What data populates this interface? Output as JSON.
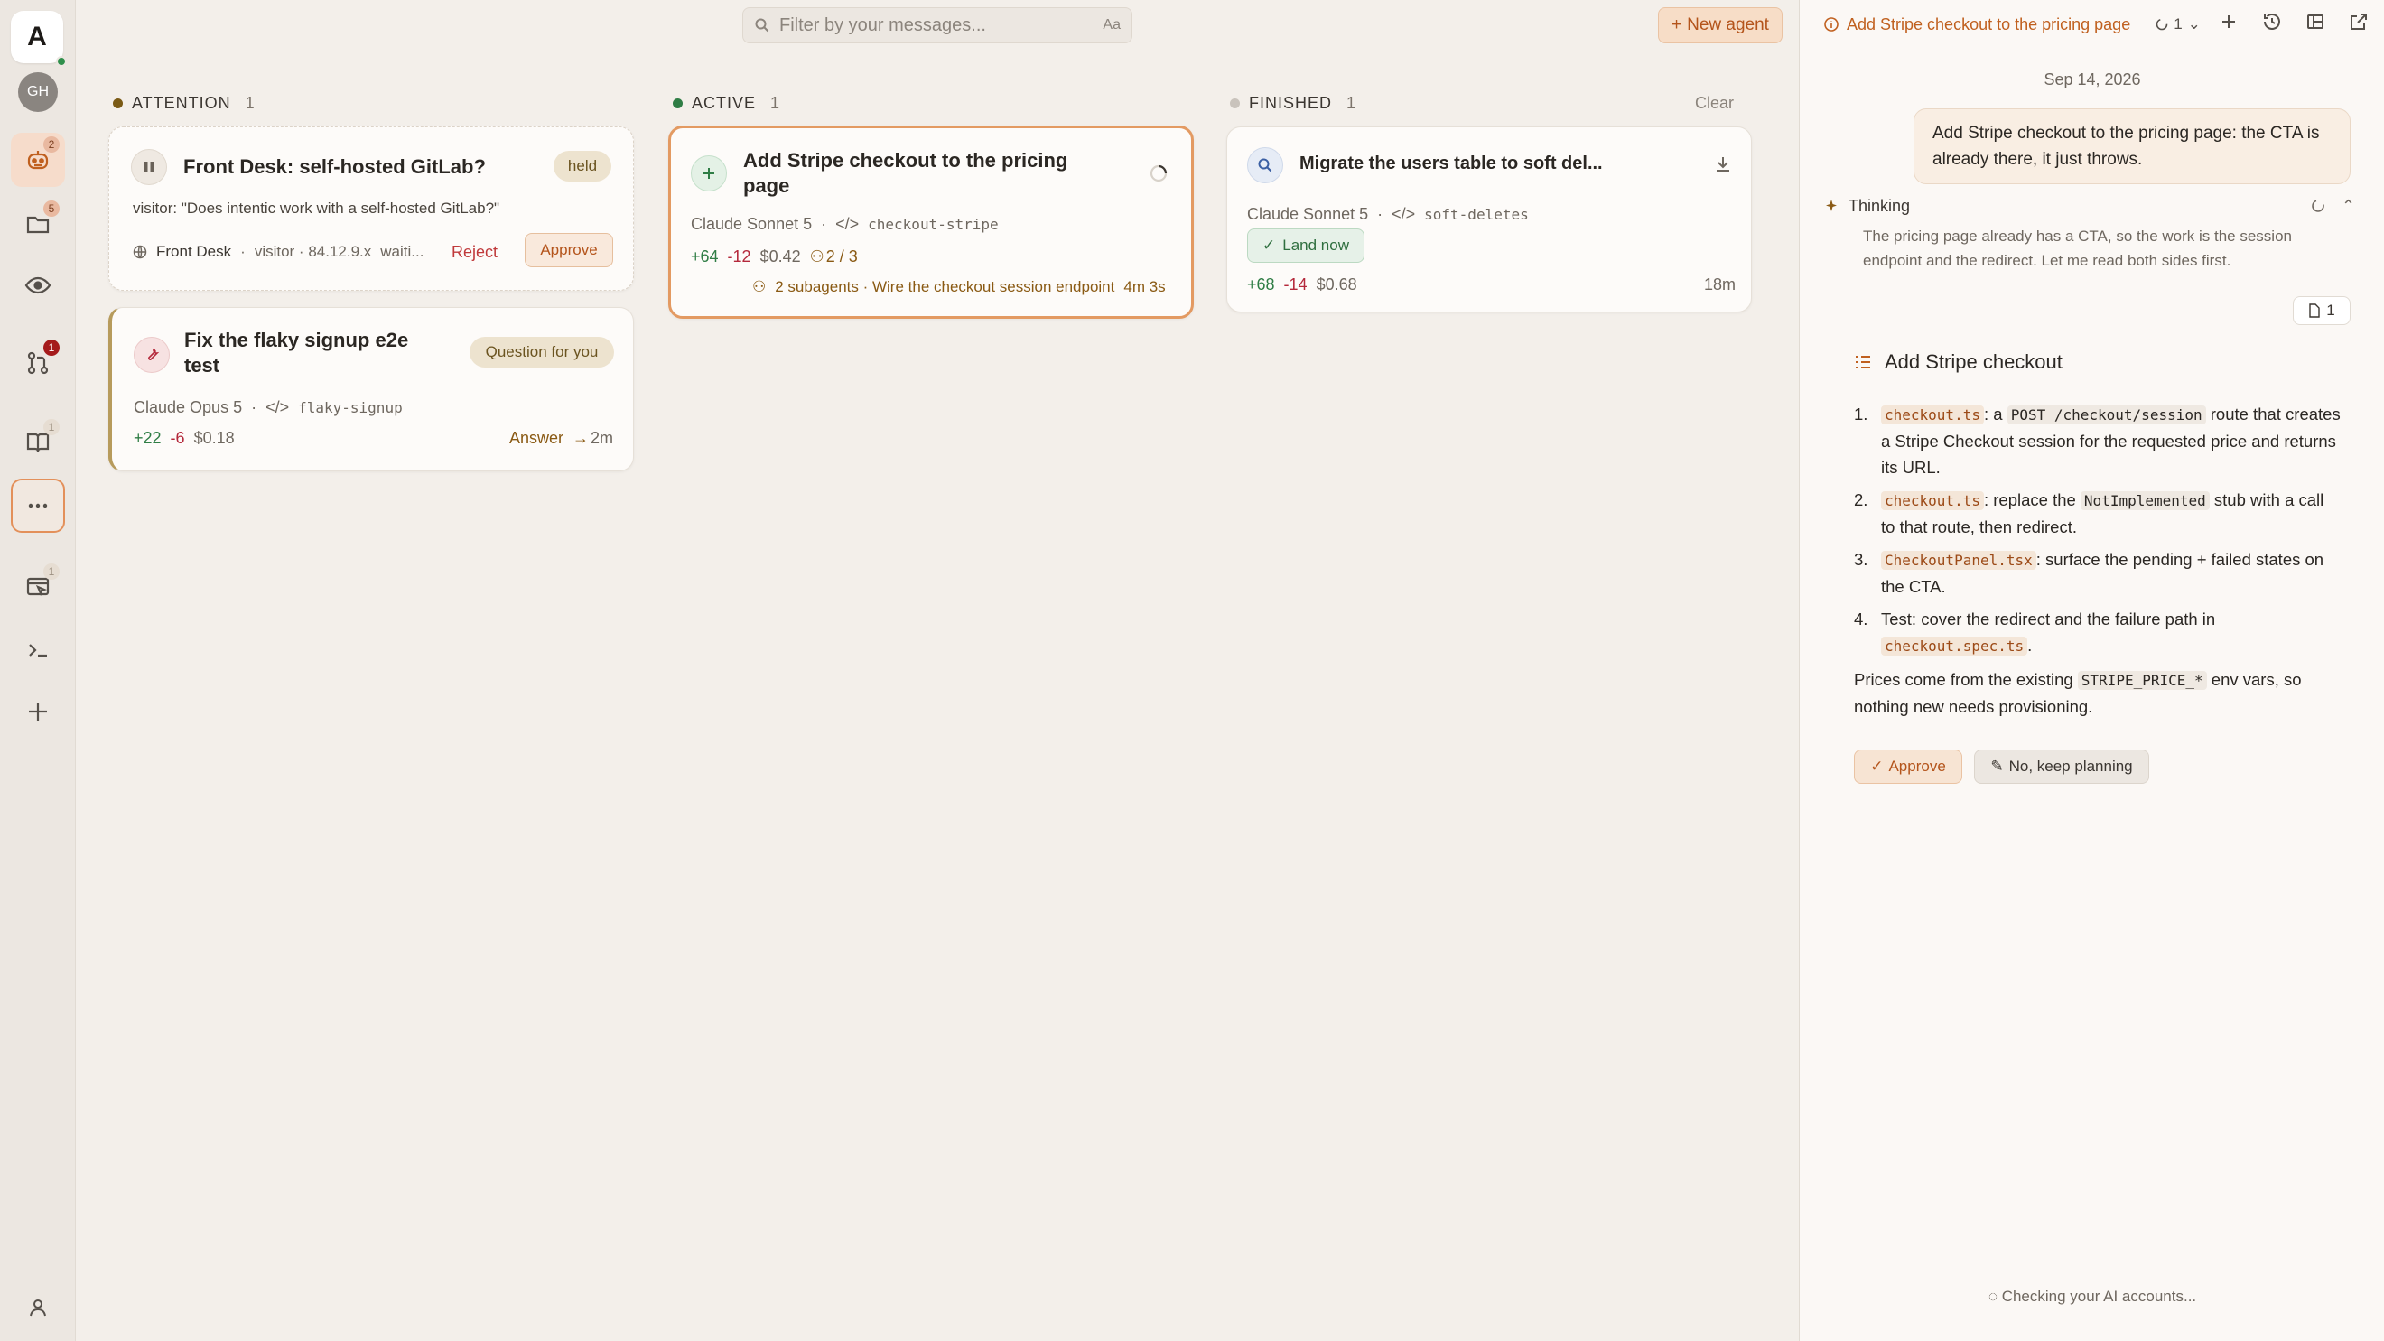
{
  "rail": {
    "app_initial": "A",
    "user_initials": "GH",
    "badges": {
      "agents": "2",
      "files": "5",
      "review": "1",
      "docs": "1",
      "browser": "1"
    }
  },
  "search": {
    "placeholder": "Filter by your messages...",
    "case_toggle": "Aa"
  },
  "new_agent_label": "New agent",
  "columns": {
    "attention": {
      "label": "ATTENTION",
      "count": "1",
      "color": "#7a5a15"
    },
    "active": {
      "label": "ACTIVE",
      "count": "1",
      "color": "#2f7d45"
    },
    "finished": {
      "label": "FINISHED",
      "count": "1",
      "color": "#c9c3bc",
      "clear_label": "Clear"
    }
  },
  "cards": {
    "front_desk": {
      "title": "Front Desk: self-hosted GitLab?",
      "badge": "held",
      "message": "visitor: \"Does intentic work with a self-hosted GitLab?\"",
      "source": "Front Desk",
      "visitor": "visitor · 84.12.9.x",
      "status": "waiti...",
      "reject": "Reject",
      "approve": "Approve"
    },
    "flaky": {
      "title_line1": "Fix the flaky signup e2e",
      "title_line2": "test",
      "badge": "Question for you",
      "model": "Claude Opus 5",
      "branch": "flaky-signup",
      "added": "+22",
      "removed": "-6",
      "cost": "$0.18",
      "answer": "Answer",
      "age": "2m"
    },
    "stripe": {
      "title_line1": "Add Stripe checkout to the pricing",
      "title_line2": "page",
      "model": "Claude Sonnet 5",
      "branch": "checkout-stripe",
      "added": "+64",
      "removed": "-12",
      "cost": "$0.42",
      "agents": "2 / 3",
      "subagents": "2 subagents · Wire the checkout session endpoint",
      "elapsed": "4m 3s"
    },
    "migrate": {
      "title": "Migrate the users table to soft del...",
      "model": "Claude Sonnet 5",
      "branch": "soft-deletes",
      "land": "Land now",
      "added": "+68",
      "removed": "-14",
      "cost": "$0.68",
      "age": "18m"
    }
  },
  "panel": {
    "title": "Add Stripe checkout to the pricing page",
    "run_count": "1",
    "date": "Sep 14, 2026",
    "user_message": "Add Stripe checkout to the pricing page: the CTA is already there, it just throws.",
    "thinking_label": "Thinking",
    "thinking_text": "The pricing page already has a CTA, so the work is the session endpoint and the redirect. Let me read both sides first.",
    "file_count": "1",
    "plan_title": "Add Stripe checkout",
    "plan": [
      {
        "n": "1.",
        "file": "checkout.ts",
        "pre": ": a ",
        "code": "POST /checkout/session",
        "post": " route that creates a Stripe Checkout session for the requested price and returns its URL."
      },
      {
        "n": "2.",
        "file": "checkout.ts",
        "pre": ": replace the ",
        "code": "NotImplemented",
        "post": " stub with a call to that route, then redirect."
      },
      {
        "n": "3.",
        "file": "CheckoutPanel.tsx",
        "pre": ": surface the pending + failed states on the CTA.",
        "code": "",
        "post": ""
      },
      {
        "n": "4.",
        "file": "",
        "pre": "Test: cover the redirect and the failure path in ",
        "code": "checkout.spec.ts",
        "post": "."
      }
    ],
    "note_pre": "Prices come from the existing ",
    "note_code": "STRIPE_PRICE_*",
    "note_post": " env vars, so nothing new needs provisioning.",
    "approve": "Approve",
    "keep_planning": "No, keep planning",
    "checking": "Checking your AI accounts..."
  }
}
